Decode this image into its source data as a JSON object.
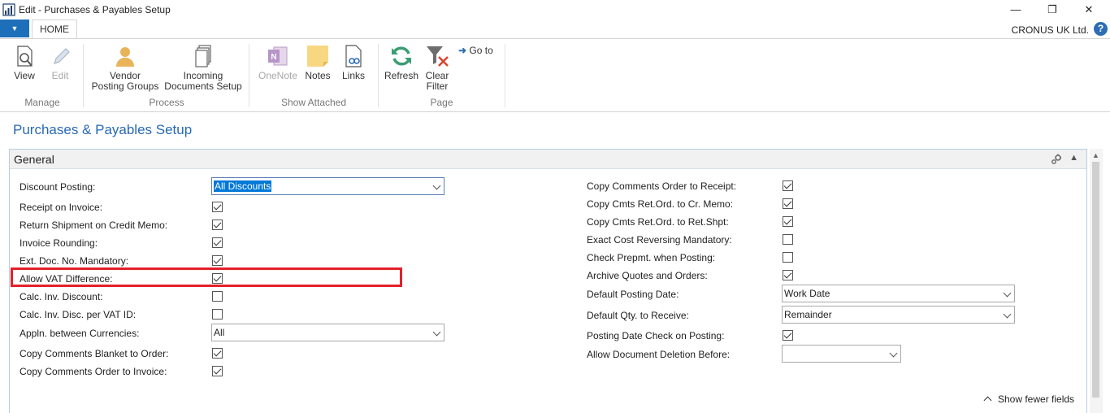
{
  "window": {
    "title": "Edit - Purchases & Payables Setup",
    "minimize_glyph": "—",
    "maximize_glyph": "❐",
    "close_glyph": "✕"
  },
  "ribbon_tabs": {
    "app_menu_glyph": "▼",
    "home": "HOME",
    "company": "CRONUS UK Ltd.",
    "help_glyph": "?"
  },
  "ribbon": {
    "manage": {
      "label": "Manage",
      "view": "View",
      "edit": "Edit"
    },
    "process": {
      "label": "Process",
      "vendor_posting_groups_1": "Vendor",
      "vendor_posting_groups_2": "Posting Groups",
      "incoming_docs_1": "Incoming",
      "incoming_docs_2": "Documents Setup"
    },
    "show_attached": {
      "label": "Show Attached",
      "onenote": "OneNote",
      "notes": "Notes",
      "links": "Links"
    },
    "page": {
      "label": "Page",
      "refresh": "Refresh",
      "clear_filter_1": "Clear",
      "clear_filter_2": "Filter",
      "goto": "Go to"
    }
  },
  "page_title": "Purchases & Payables Setup",
  "general": {
    "title": "General",
    "show_fewer": "Show fewer fields",
    "left_fields": [
      {
        "label": "Discount Posting:",
        "type": "select",
        "value": "All Discounts"
      },
      {
        "label": "Receipt on Invoice:",
        "type": "checkbox",
        "checked": true
      },
      {
        "label": "Return Shipment on Credit Memo:",
        "type": "checkbox",
        "checked": true
      },
      {
        "label": "Invoice Rounding:",
        "type": "checkbox",
        "checked": true
      },
      {
        "label": "Ext. Doc. No. Mandatory:",
        "type": "checkbox",
        "checked": true
      },
      {
        "label": "Allow VAT Difference:",
        "type": "checkbox",
        "checked": true
      },
      {
        "label": "Calc. Inv. Discount:",
        "type": "checkbox",
        "checked": false
      },
      {
        "label": "Calc. Inv. Disc. per VAT ID:",
        "type": "checkbox",
        "checked": false
      },
      {
        "label": "Appln. between Currencies:",
        "type": "select",
        "value": "All"
      },
      {
        "label": "Copy Comments Blanket to Order:",
        "type": "checkbox",
        "checked": true
      },
      {
        "label": "Copy Comments Order to Invoice:",
        "type": "checkbox",
        "checked": true
      }
    ],
    "right_fields": [
      {
        "label": "Copy Comments Order to Receipt:",
        "type": "checkbox",
        "checked": true
      },
      {
        "label": "Copy Cmts Ret.Ord. to Cr. Memo:",
        "type": "checkbox",
        "checked": true
      },
      {
        "label": "Copy Cmts Ret.Ord. to Ret.Shpt:",
        "type": "checkbox",
        "checked": true
      },
      {
        "label": "Exact Cost Reversing Mandatory:",
        "type": "checkbox",
        "checked": false
      },
      {
        "label": "Check Prepmt. when Posting:",
        "type": "checkbox",
        "checked": false
      },
      {
        "label": "Archive Quotes and Orders:",
        "type": "checkbox",
        "checked": true
      },
      {
        "label": "Default Posting Date:",
        "type": "select",
        "value": "Work Date"
      },
      {
        "label": "Default Qty. to Receive:",
        "type": "select",
        "value": "Remainder"
      },
      {
        "label": "Posting Date Check on Posting:",
        "type": "checkbox",
        "checked": true
      },
      {
        "label": "Allow Document Deletion Before:",
        "type": "select",
        "value": ""
      }
    ]
  },
  "colors": {
    "accent": "#2769b6",
    "highlight": "#e3212b",
    "app_menu": "#1e6fba"
  }
}
